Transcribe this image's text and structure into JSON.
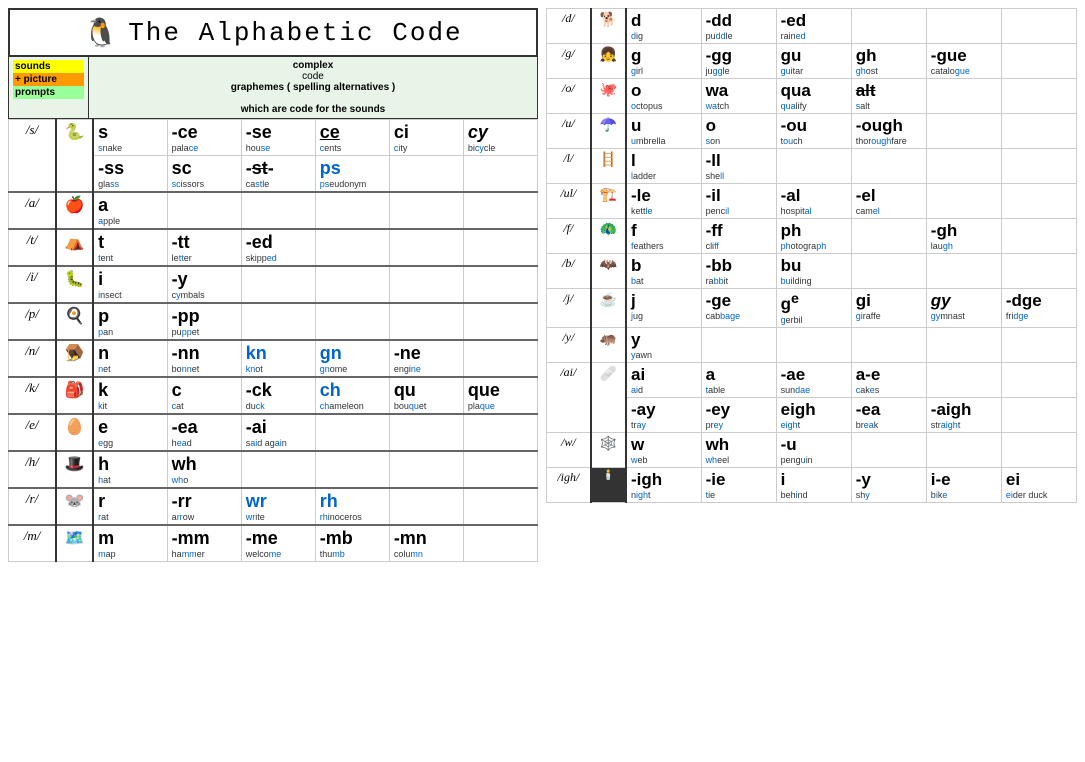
{
  "left": {
    "title": "The Alphabetic Code",
    "header": {
      "sounds_label": "sounds",
      "picture_label": "+ picture",
      "prompts_label": "prompts",
      "complex_label": "complex code",
      "graphemes_label": "graphemes  ( spelling alternatives )",
      "which_label": "which are code for the sounds"
    },
    "rows": []
  },
  "right": {
    "rows": []
  }
}
